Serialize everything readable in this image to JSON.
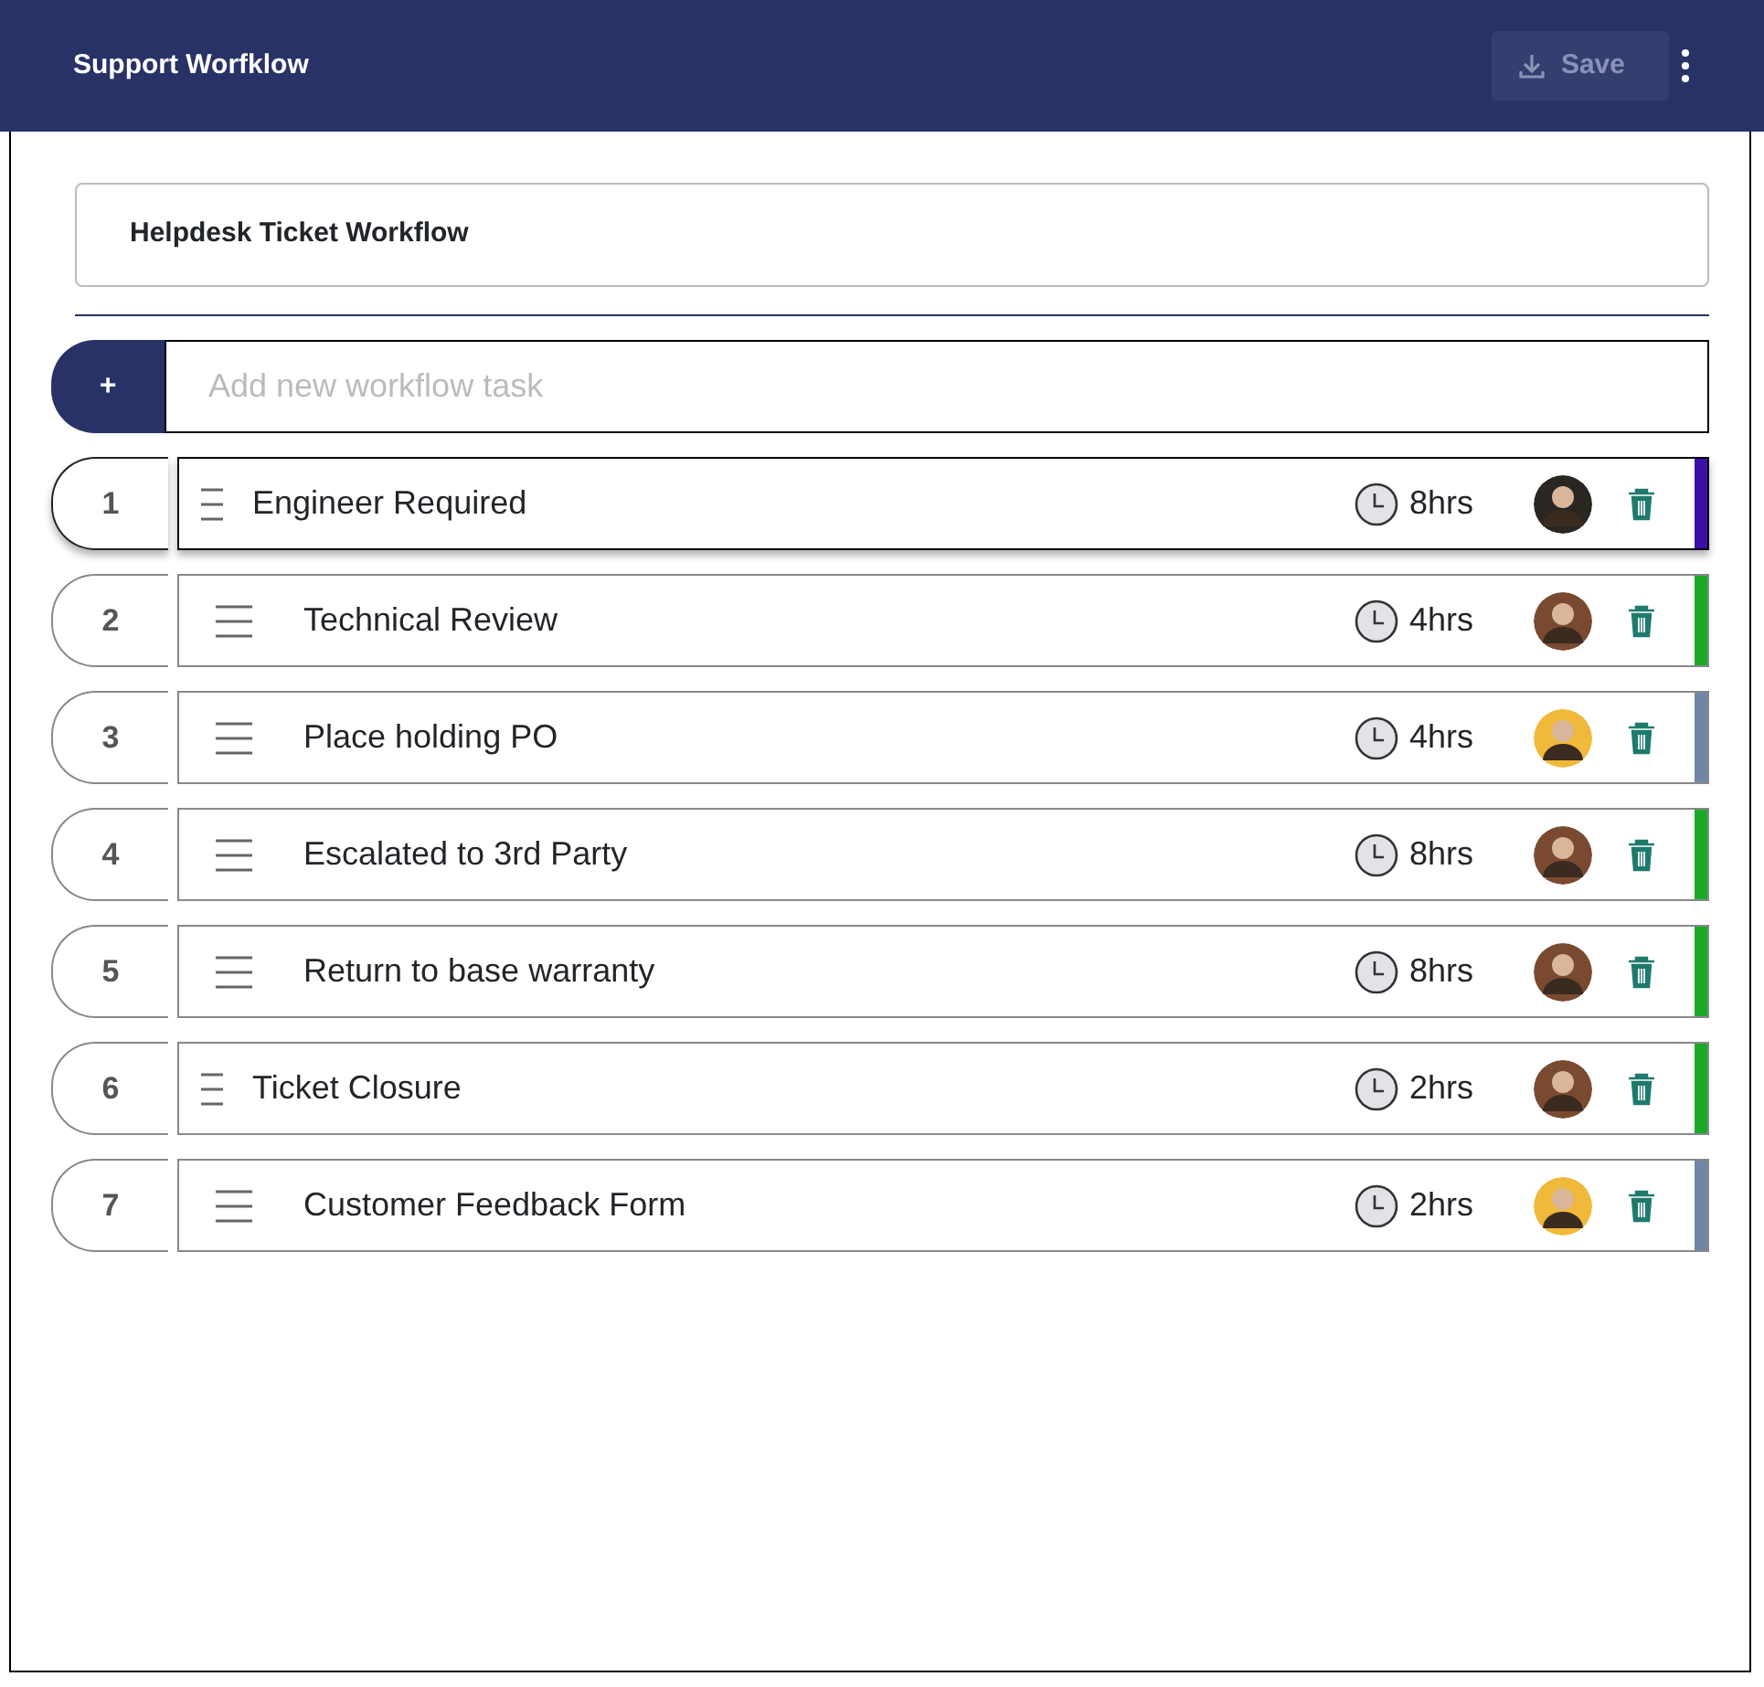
{
  "app_bar": {
    "title": "Support Worfklow",
    "save_button": {
      "label": "Save",
      "disabled": true
    }
  },
  "workflow_name": "Helpdesk Ticket Workflow",
  "new_task": {
    "add_label": "+",
    "placeholder": "Add new workflow task"
  },
  "tasks": [
    {
      "number": "1",
      "title": "Engineer Required",
      "hours": "8hrs",
      "color": "#3a10a8",
      "avatar": {
        "color": "#2a2622"
      },
      "selected": true,
      "children": [
        {
          "number": "2",
          "title": "Technical Review",
          "hours": "4hrs",
          "color": "#1aaa2a",
          "avatar": {
            "color": "#7a4a30"
          },
          "selected": false
        },
        {
          "number": "3",
          "title": "Place holding PO",
          "hours": "4hrs",
          "color": "#6f86a6",
          "avatar": {
            "color": "#f0b93a"
          },
          "selected": false
        },
        {
          "number": "4",
          "title": "Escalated to 3rd Party",
          "hours": "8hrs",
          "color": "#1aaa2a",
          "avatar": {
            "color": "#7a4a30"
          },
          "selected": false
        },
        {
          "number": "5",
          "title": "Return to base warranty",
          "hours": "8hrs",
          "color": "#1aaa2a",
          "avatar": {
            "color": "#7a4a30"
          },
          "selected": false
        }
      ]
    },
    {
      "number": "6",
      "title": "Ticket Closure",
      "hours": "2hrs",
      "color": "#1aaa2a",
      "avatar": {
        "color": "#7a4a30"
      },
      "selected": false,
      "children": [
        {
          "number": "7",
          "title": "Customer Feedback Form",
          "hours": "2hrs",
          "color": "#6f86a6",
          "avatar": {
            "color": "#f0b93a"
          },
          "selected": false
        }
      ]
    }
  ]
}
